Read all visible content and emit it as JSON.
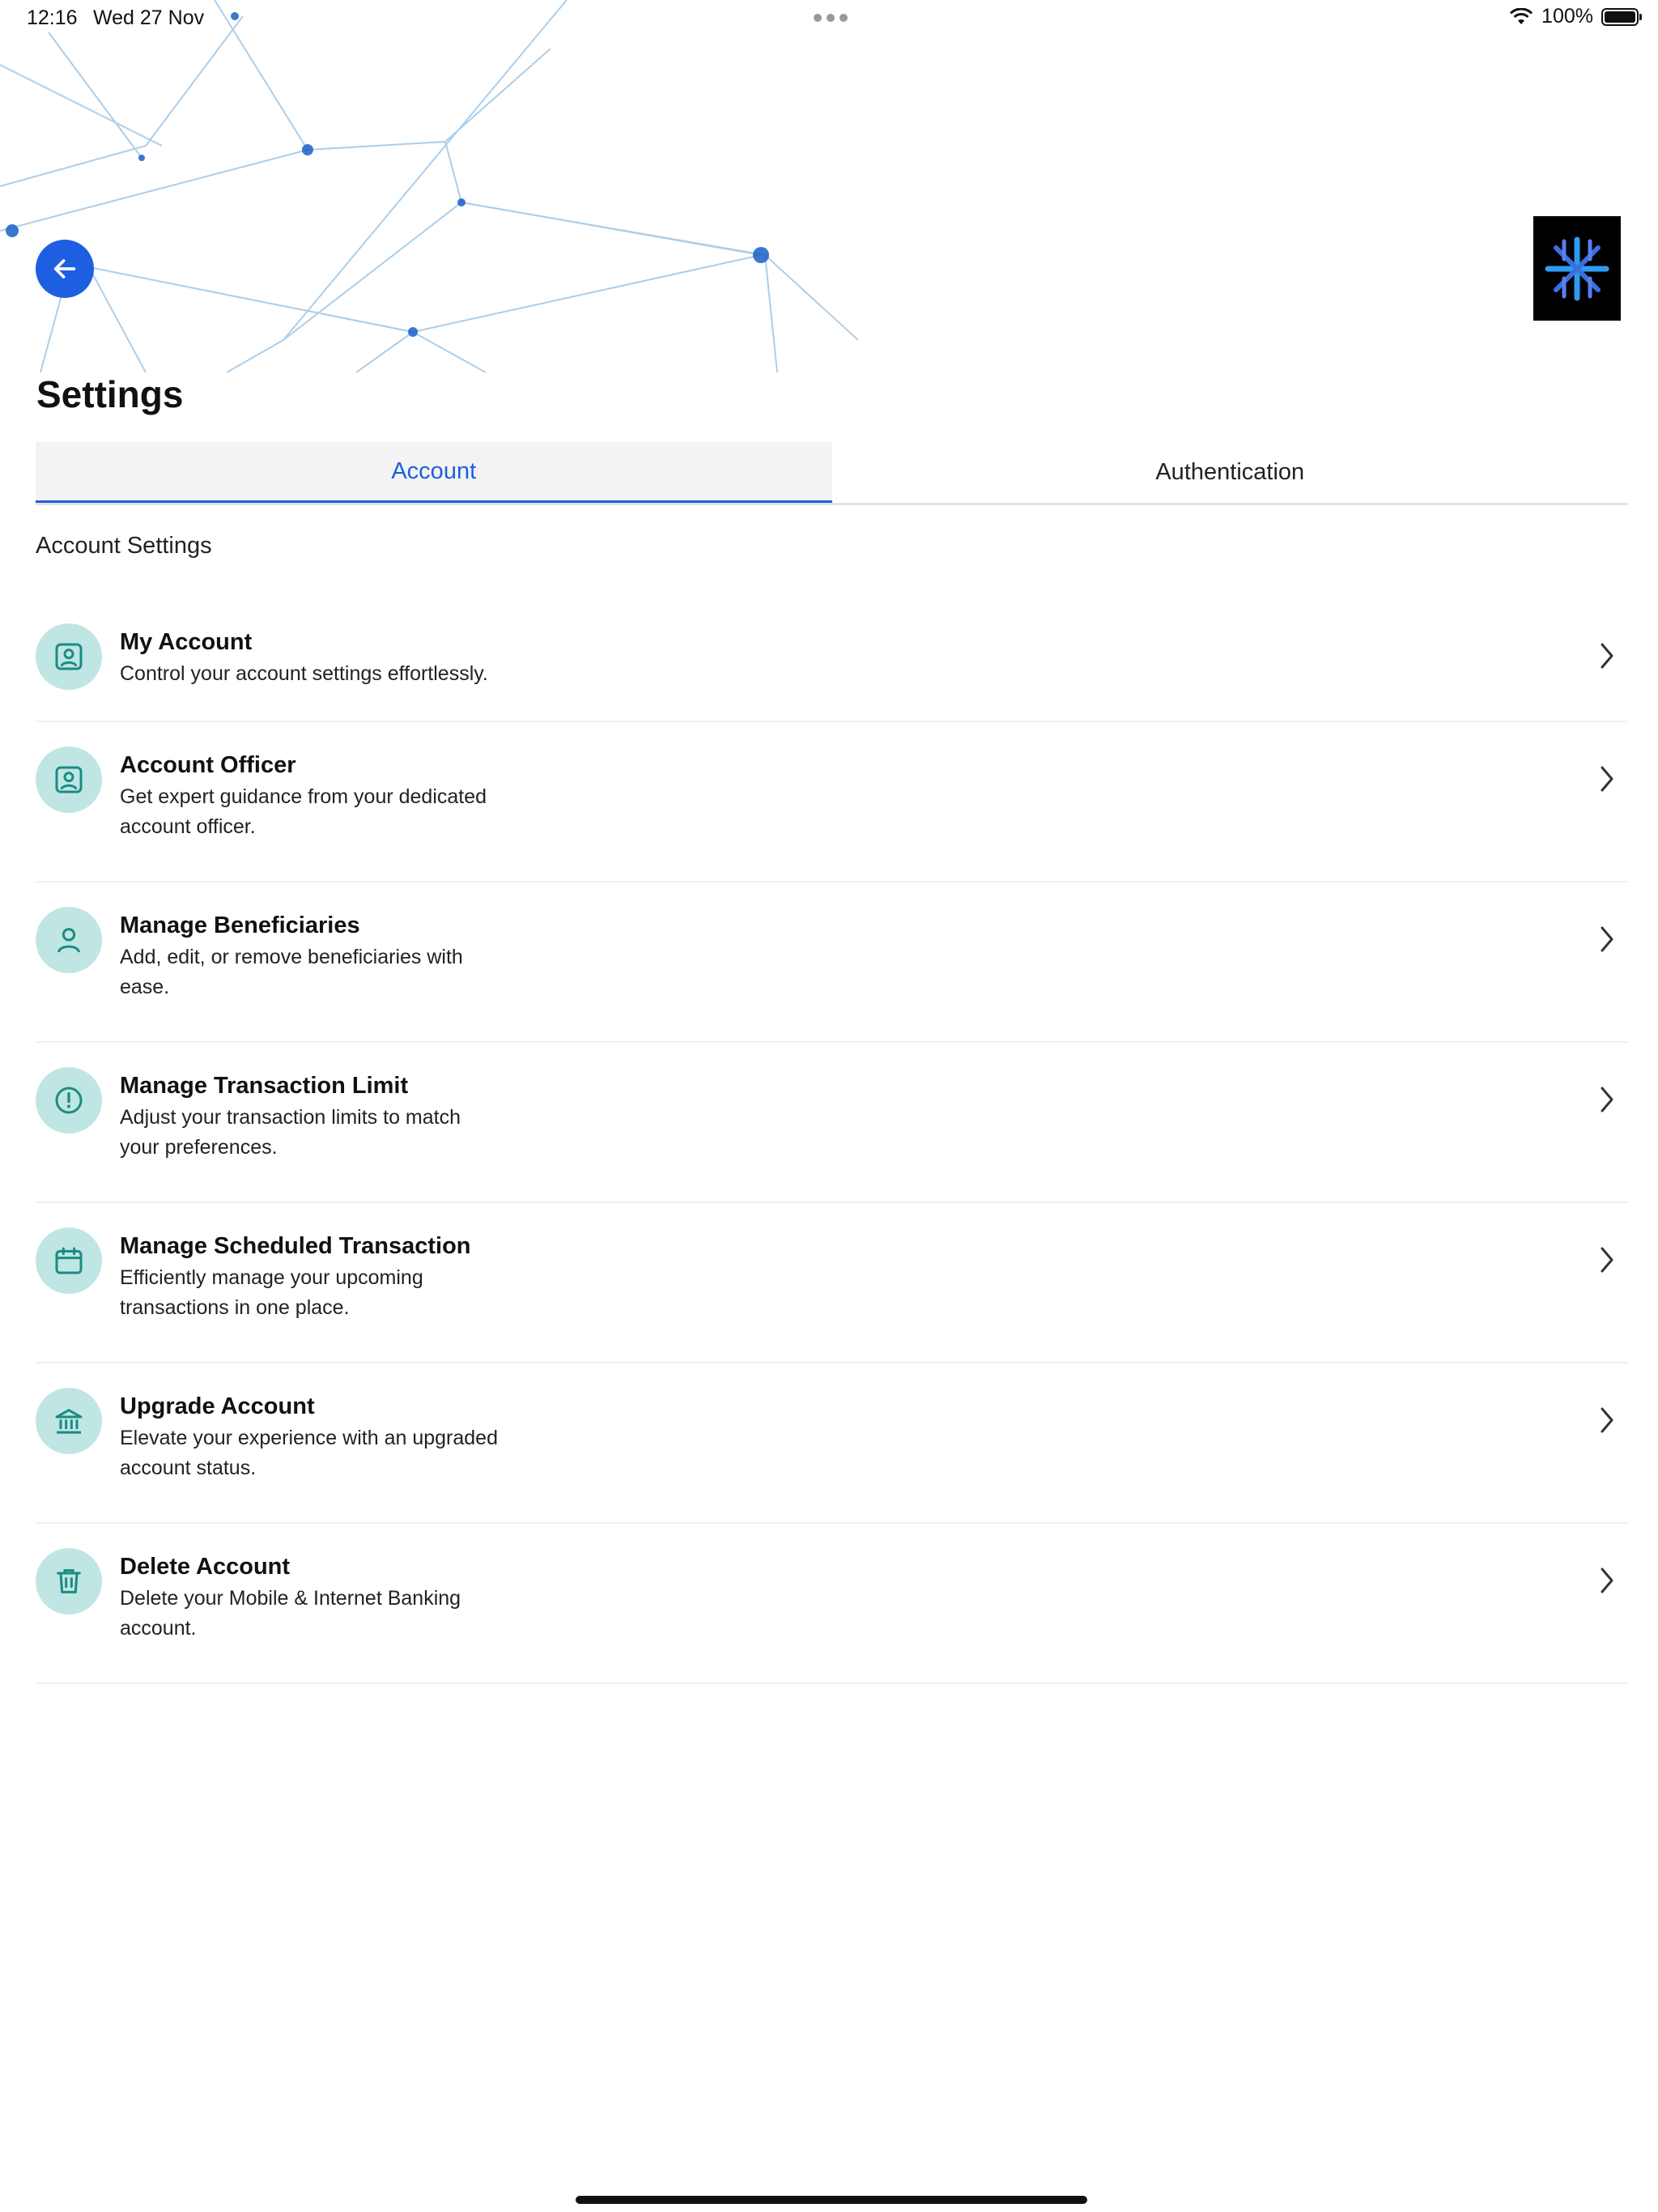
{
  "status_bar": {
    "time": "12:16",
    "date": "Wed 27 Nov",
    "battery": "100%",
    "wifi_icon": "wifi-icon",
    "battery_icon": "battery-icon"
  },
  "header": {
    "back_icon": "arrow-left-icon",
    "logo_icon": "snowflake-logo",
    "title": "Settings"
  },
  "tabs": [
    {
      "label": "Account",
      "active": true
    },
    {
      "label": "Authentication",
      "active": false
    }
  ],
  "section_label": "Account Settings",
  "items": [
    {
      "title": "My Account",
      "desc_lines": [
        "Control your account settings effortlessly."
      ],
      "icon": "contact-card-icon"
    },
    {
      "title": "Account Officer",
      "desc_lines": [
        "Get expert guidance from your dedicated",
        "account officer."
      ],
      "icon": "contact-card-icon"
    },
    {
      "title": "Manage Beneficiaries",
      "desc_lines": [
        "Add, edit, or remove beneficiaries with",
        "ease."
      ],
      "icon": "user-icon"
    },
    {
      "title": "Manage Transaction Limit",
      "desc_lines": [
        "Adjust your transaction limits to match",
        "your preferences."
      ],
      "icon": "alert-circle-icon"
    },
    {
      "title": "Manage Scheduled Transaction",
      "desc_lines": [
        "Efficiently manage your upcoming",
        "transactions in one place."
      ],
      "icon": "calendar-icon"
    },
    {
      "title": "Upgrade Account",
      "desc_lines": [
        "Elevate your experience with an upgraded",
        "account status."
      ],
      "icon": "bank-icon"
    },
    {
      "title": "Delete Account",
      "desc_lines": [
        "Delete your Mobile & Internet Banking",
        "account."
      ],
      "icon": "trash-icon"
    }
  ],
  "colors": {
    "accent": "#1d5fe0",
    "icon_bg": "#bfe6e3",
    "icon_stroke": "#1a8c83"
  }
}
